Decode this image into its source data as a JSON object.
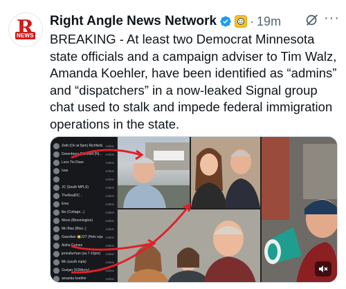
{
  "post": {
    "author_name": "Right Angle News Network",
    "time": "19m",
    "separator": "·",
    "avatar_letter": "R",
    "avatar_tag": "NEWS",
    "text": "BREAKING - At least two Democrat Minnesota state officials and a campaign adviser to Tim Walz, Amanda Koehler, have been identified as “admins” and “dispatchers” in a now-leaked Signal group chat used to stalk and impede federal immigration operations in the state."
  },
  "icons": {
    "verified": "verified-badge-icon",
    "affiliate": "affiliate-badge-icon",
    "grok": "grok-icon",
    "more": "more-options-icon",
    "mute": "volume-muted-icon"
  },
  "colors": {
    "text": "#0f1419",
    "muted": "#536471",
    "verified": "#1d9bf0",
    "brand_red": "#d11a1a",
    "annotation_red": "#e0202a"
  },
  "chat_list": [
    "Zeth (On at 5pm) Richfield...",
    "Greenberry-Richfield (N)...",
    "Loco Tio Dave",
    "Ivan",
    "",
    "JC (South MPLS)",
    "TheRealDC...",
    "Emo",
    "tbs (Cottage...)",
    "Moon (Bloomington)",
    "Mn Bias (Bloo..)",
    "Gaurdian 🌟227 (Helo squad)",
    "Aisha Gomez",
    "jennafurman (sa 7-10pm)",
    "Mn (south mpls)",
    "Gunjan (SSMerry)",
    "amanda koehler"
  ],
  "chat_role": "Admin"
}
